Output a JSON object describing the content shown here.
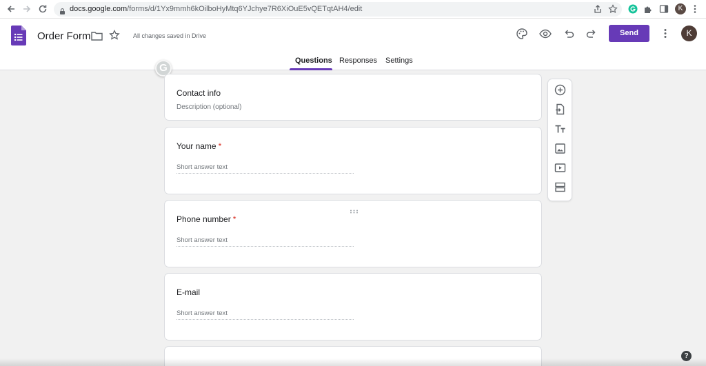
{
  "browser": {
    "url_host": "docs.google.com",
    "url_path": "/forms/d/1Yx9mmh6kOilboHyMtq6YJchye7R6XiOuE5vQETqtAH4/edit",
    "profile_initial": "K",
    "icons": [
      "back-arrow-icon",
      "forward-arrow-icon",
      "reload-icon",
      "lock-icon",
      "share-icon",
      "bookmark-star-icon",
      "grammarly-extension-icon",
      "extensions-puzzle-icon",
      "side-panel-icon",
      "kebab-menu-icon"
    ]
  },
  "header": {
    "title": "Order Form",
    "save_status": "All changes saved in Drive",
    "send_label": "Send",
    "avatar_initial": "K",
    "accent_color": "#673ab7",
    "icons": [
      "forms-logo-icon",
      "folder-icon",
      "star-icon",
      "palette-icon",
      "preview-eye-icon",
      "undo-icon",
      "redo-icon",
      "more-vert-icon"
    ]
  },
  "tabs": [
    {
      "label": "Questions",
      "active": true
    },
    {
      "label": "Responses",
      "active": false
    },
    {
      "label": "Settings",
      "active": false
    }
  ],
  "grammarly_badge": "G",
  "cards": [
    {
      "title": "Contact info",
      "description": "Description (optional)"
    },
    {
      "title": "Your name",
      "required": "*",
      "answer_placeholder": "Short answer text"
    },
    {
      "title": "Phone number",
      "required": "*",
      "answer_placeholder": "Short answer text"
    },
    {
      "title": "E-mail",
      "answer_placeholder": "Short answer text"
    }
  ],
  "side_toolbar": [
    "add-question-icon",
    "import-questions-icon",
    "add-title-icon",
    "add-image-icon",
    "add-video-icon",
    "add-section-icon"
  ],
  "help_label": "?"
}
